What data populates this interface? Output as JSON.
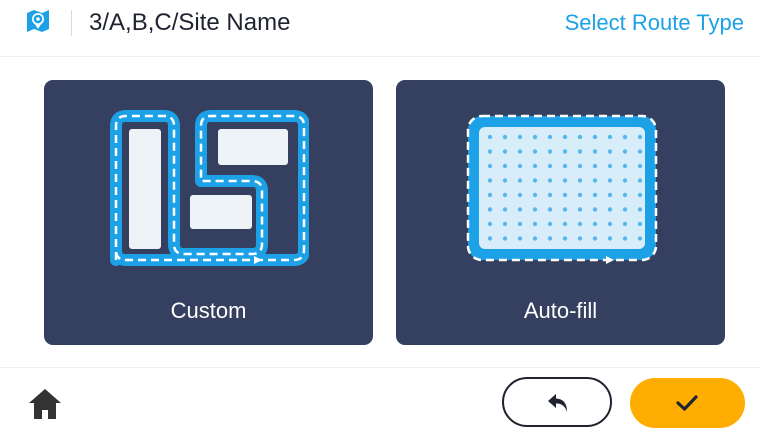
{
  "header": {
    "logo_icon": "map-pin-logo-icon",
    "breadcrumb": "3/A,B,C/Site Name",
    "title": "Select Route Type"
  },
  "route_types": [
    {
      "label": "Custom",
      "icon": "custom-route-icon",
      "selected": false
    },
    {
      "label": "Auto-fill",
      "icon": "auto-fill-route-icon",
      "selected": false
    }
  ],
  "footer": {
    "home_icon": "home-icon",
    "back_icon": "undo-arrow-icon",
    "confirm_icon": "checkmark-icon"
  },
  "colors": {
    "accent": "#1da1e6",
    "card_bg": "#353f60",
    "confirm": "#ffad00",
    "text_dark": "#1f2330"
  }
}
